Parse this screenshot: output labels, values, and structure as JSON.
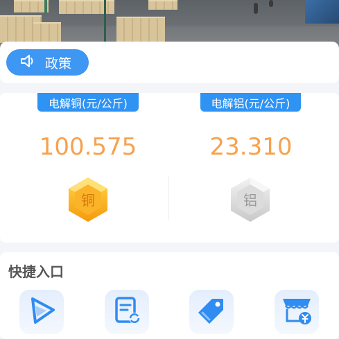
{
  "policy": {
    "label": "政策",
    "icon": "speaker-icon"
  },
  "prices": [
    {
      "name": "电解铜(元/公斤)",
      "value": "100.575",
      "gem_char": "铜",
      "color": "#f7a14d"
    },
    {
      "name": "电解铝(元/公斤)",
      "value": "23.310",
      "gem_char": "铝",
      "color": "#f7a14d"
    }
  ],
  "quick": {
    "title": "快捷入口",
    "entries": [
      {
        "icon": "play-icon"
      },
      {
        "icon": "document-refresh-icon"
      },
      {
        "icon": "price-tag-icon"
      },
      {
        "icon": "store-yuan-icon"
      }
    ]
  },
  "colors": {
    "accent": "#2f93f3",
    "price": "#f7a14d"
  }
}
